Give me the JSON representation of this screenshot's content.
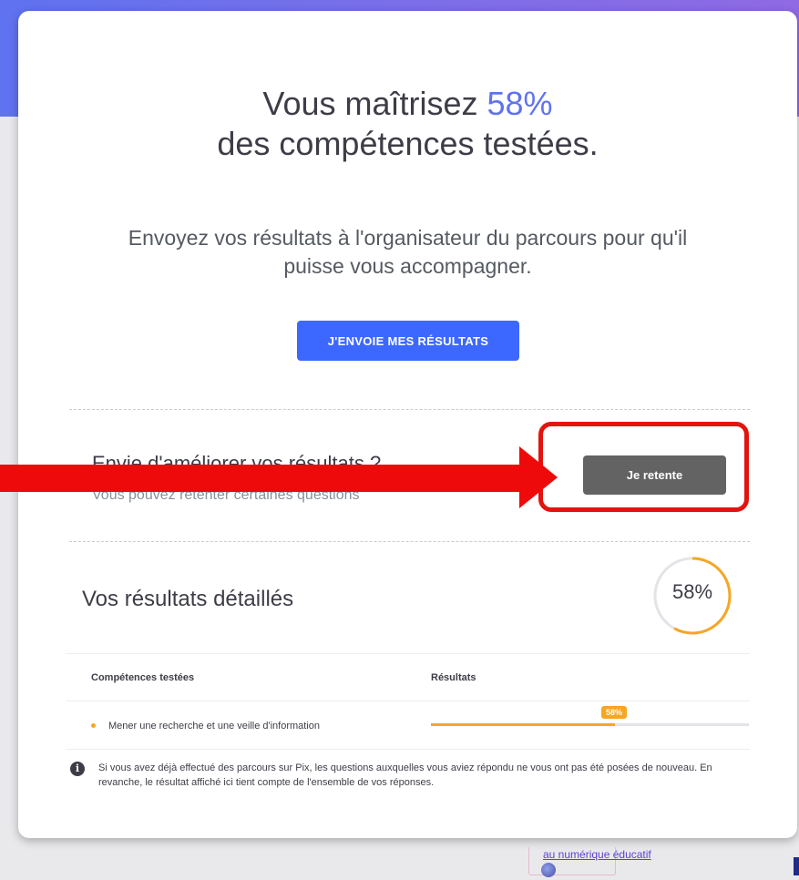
{
  "result": {
    "headline_prefix": "Vous maîtrisez ",
    "percentage": "58%",
    "headline_suffix": "des compétences testées."
  },
  "send": {
    "message": "Envoyez vos résultats à l'organisateur du parcours pour qu'il puisse vous accompagner.",
    "button_label": "J'ENVOIE MES RÉSULTATS"
  },
  "improve": {
    "title": "Envie d'améliorer vos résultats ?",
    "subtitle": "Vous pouvez retenter certaines questions",
    "button_label": "Je retente"
  },
  "details": {
    "title": "Vos résultats détaillés",
    "gauge_label": "58%",
    "gauge_value": 0.58,
    "columns": [
      "Compétences testées",
      "Résultats"
    ],
    "rows": [
      {
        "label": "Mener une recherche et une veille d'information",
        "value": 0.58,
        "value_label": "58%"
      }
    ],
    "note": "Si vous avez déjà effectué des parcours sur Pix, les questions auxquelles vous aviez répondu ne vous ont pas été posées de nouveau. En revanche, le résultat affiché ici tient compte de l'ensemble de vos réponses."
  },
  "footer": {
    "link_text": "au numérique éducatif"
  },
  "colors": {
    "accent": "#5f72f0",
    "primary_button": "#3d68ff",
    "retry_button": "#636363",
    "progress": "#f6a623",
    "annotation_red": "#e2140e"
  }
}
